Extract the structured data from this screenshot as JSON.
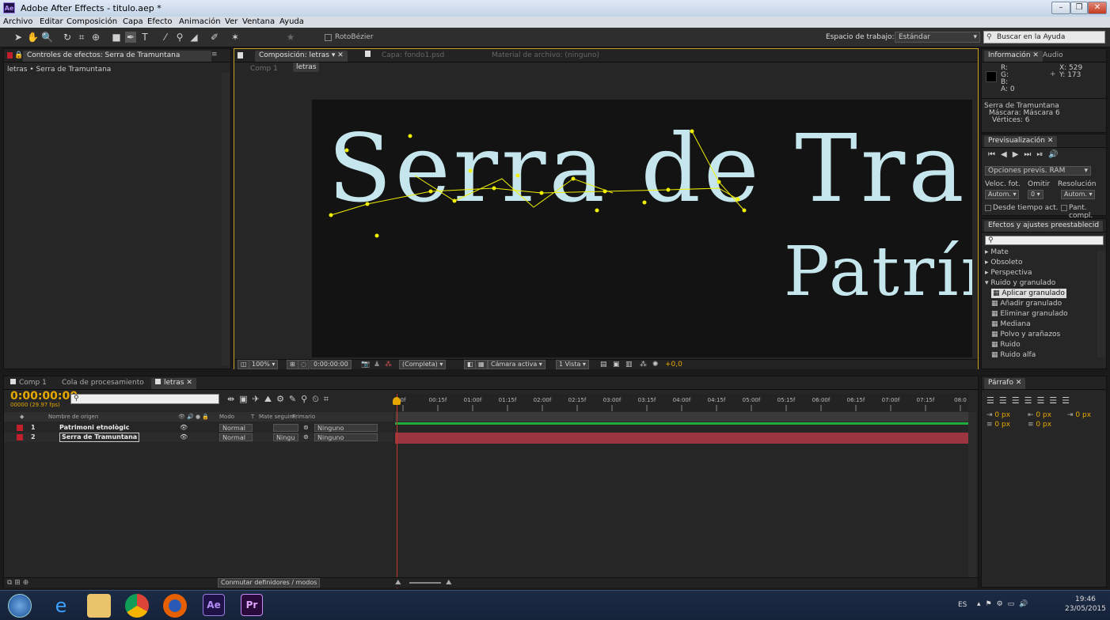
{
  "window": {
    "title": "Adobe After Effects - titulo.aep *",
    "icon": "Ae"
  },
  "menu": [
    "Archivo",
    "Editar",
    "Composición",
    "Capa",
    "Efecto",
    "Animación",
    "Ver",
    "Ventana",
    "Ayuda"
  ],
  "toolbar": {
    "rotobezier": "RotoBézier",
    "workspace_label": "Espacio de trabajo:",
    "workspace_value": "Estándar",
    "help_placeholder": "Buscar en la Ayuda"
  },
  "effects_panel": {
    "tab": "Controles de efectos: Serra de Tramuntana",
    "breadcrumb": "letras • Serra de Tramuntana"
  },
  "comp_panel": {
    "tab_comp": "Composición: letras",
    "tab_layer": "Capa: fondo1.psd",
    "tab_footage": "Material de archivo: (ninguno)",
    "crumb1": "Comp 1",
    "crumb2": "letras",
    "canvas_line1": "Serra de Tra",
    "canvas_line2": "Patrím",
    "zoom": "100%",
    "timecode": "0:00:00:00",
    "resolution": "(Completa)",
    "camera": "Cámara activa",
    "views": "1 Vista",
    "exposure": "+0,0"
  },
  "info_panel": {
    "tab1": "Información",
    "tab2": "Audio",
    "r": "R:",
    "g": "G:",
    "b": "B:",
    "a": "A: 0",
    "x": "X: 529",
    "y": "Y: 173",
    "layer": "Serra de Tramuntana",
    "mask": "Máscara: Máscara 6",
    "verts": "Vértices: 6"
  },
  "preview_panel": {
    "tab": "Previsualización",
    "ram": "Opciones previs. RAM",
    "fps_label": "Veloc. fot.",
    "skip_label": "Omitir",
    "res_label": "Resolución",
    "fps": "Autom.",
    "skip": "0",
    "res": "Autom.",
    "from_current": "Desde tiempo act.",
    "fullscreen": "Pant. compl."
  },
  "presets_panel": {
    "tab": "Efectos y ajustes preestablecid",
    "items": [
      {
        "label": "Mate",
        "indent": 0
      },
      {
        "label": "Obsoleto",
        "indent": 0
      },
      {
        "label": "Perspectiva",
        "indent": 0
      },
      {
        "label": "Ruido y granulado",
        "indent": 0,
        "open": true
      },
      {
        "label": "Aplicar granulado",
        "indent": 1,
        "selected": true
      },
      {
        "label": "Añadir granulado",
        "indent": 1
      },
      {
        "label": "Eliminar granulado",
        "indent": 1
      },
      {
        "label": "Mediana",
        "indent": 1
      },
      {
        "label": "Polvo y arañazos",
        "indent": 1
      },
      {
        "label": "Ruido",
        "indent": 1
      },
      {
        "label": "Ruido alfa",
        "indent": 1
      }
    ]
  },
  "timeline": {
    "tabs": [
      "Comp 1",
      "Cola de procesamiento",
      "letras"
    ],
    "timecode": "0:00:00:00",
    "fps": "00000 (29.97 fps)",
    "col_source": "Nombre de origen",
    "col_mode": "Modo",
    "col_t": "T",
    "col_matte": "Mate seguim.",
    "col_parent": "Primario",
    "toggle_label": "Conmutar definidores / modos",
    "layers": [
      {
        "num": "1",
        "name": "Patrimoni etnològic",
        "mode": "Normal",
        "matte": "",
        "parent": "Ninguno"
      },
      {
        "num": "2",
        "name": "Serra de Tramuntana",
        "mode": "Normal",
        "matte": "Ningu",
        "parent": "Ninguno"
      }
    ],
    "ruler": [
      "0f",
      "00:15f",
      "01:00f",
      "01:15f",
      "02:00f",
      "02:15f",
      "03:00f",
      "03:15f",
      "04:00f",
      "04:15f",
      "05:00f",
      "05:15f",
      "06:00f",
      "06:15f",
      "07:00f",
      "07:15f",
      "08:0"
    ]
  },
  "paragraph_panel": {
    "tab": "Párrafo",
    "fields": [
      "0 px",
      "0 px",
      "0 px",
      "0 px",
      "0 px"
    ]
  },
  "taskbar": {
    "lang": "ES",
    "time": "19:46",
    "date": "23/05/2015",
    "apps": [
      "Ae",
      "Pr"
    ]
  },
  "colors": {
    "accent": "#e6a800",
    "text_mask": "#c5e6ec",
    "mask_path": "#f0f000",
    "layer_red": "#c21f2c"
  }
}
